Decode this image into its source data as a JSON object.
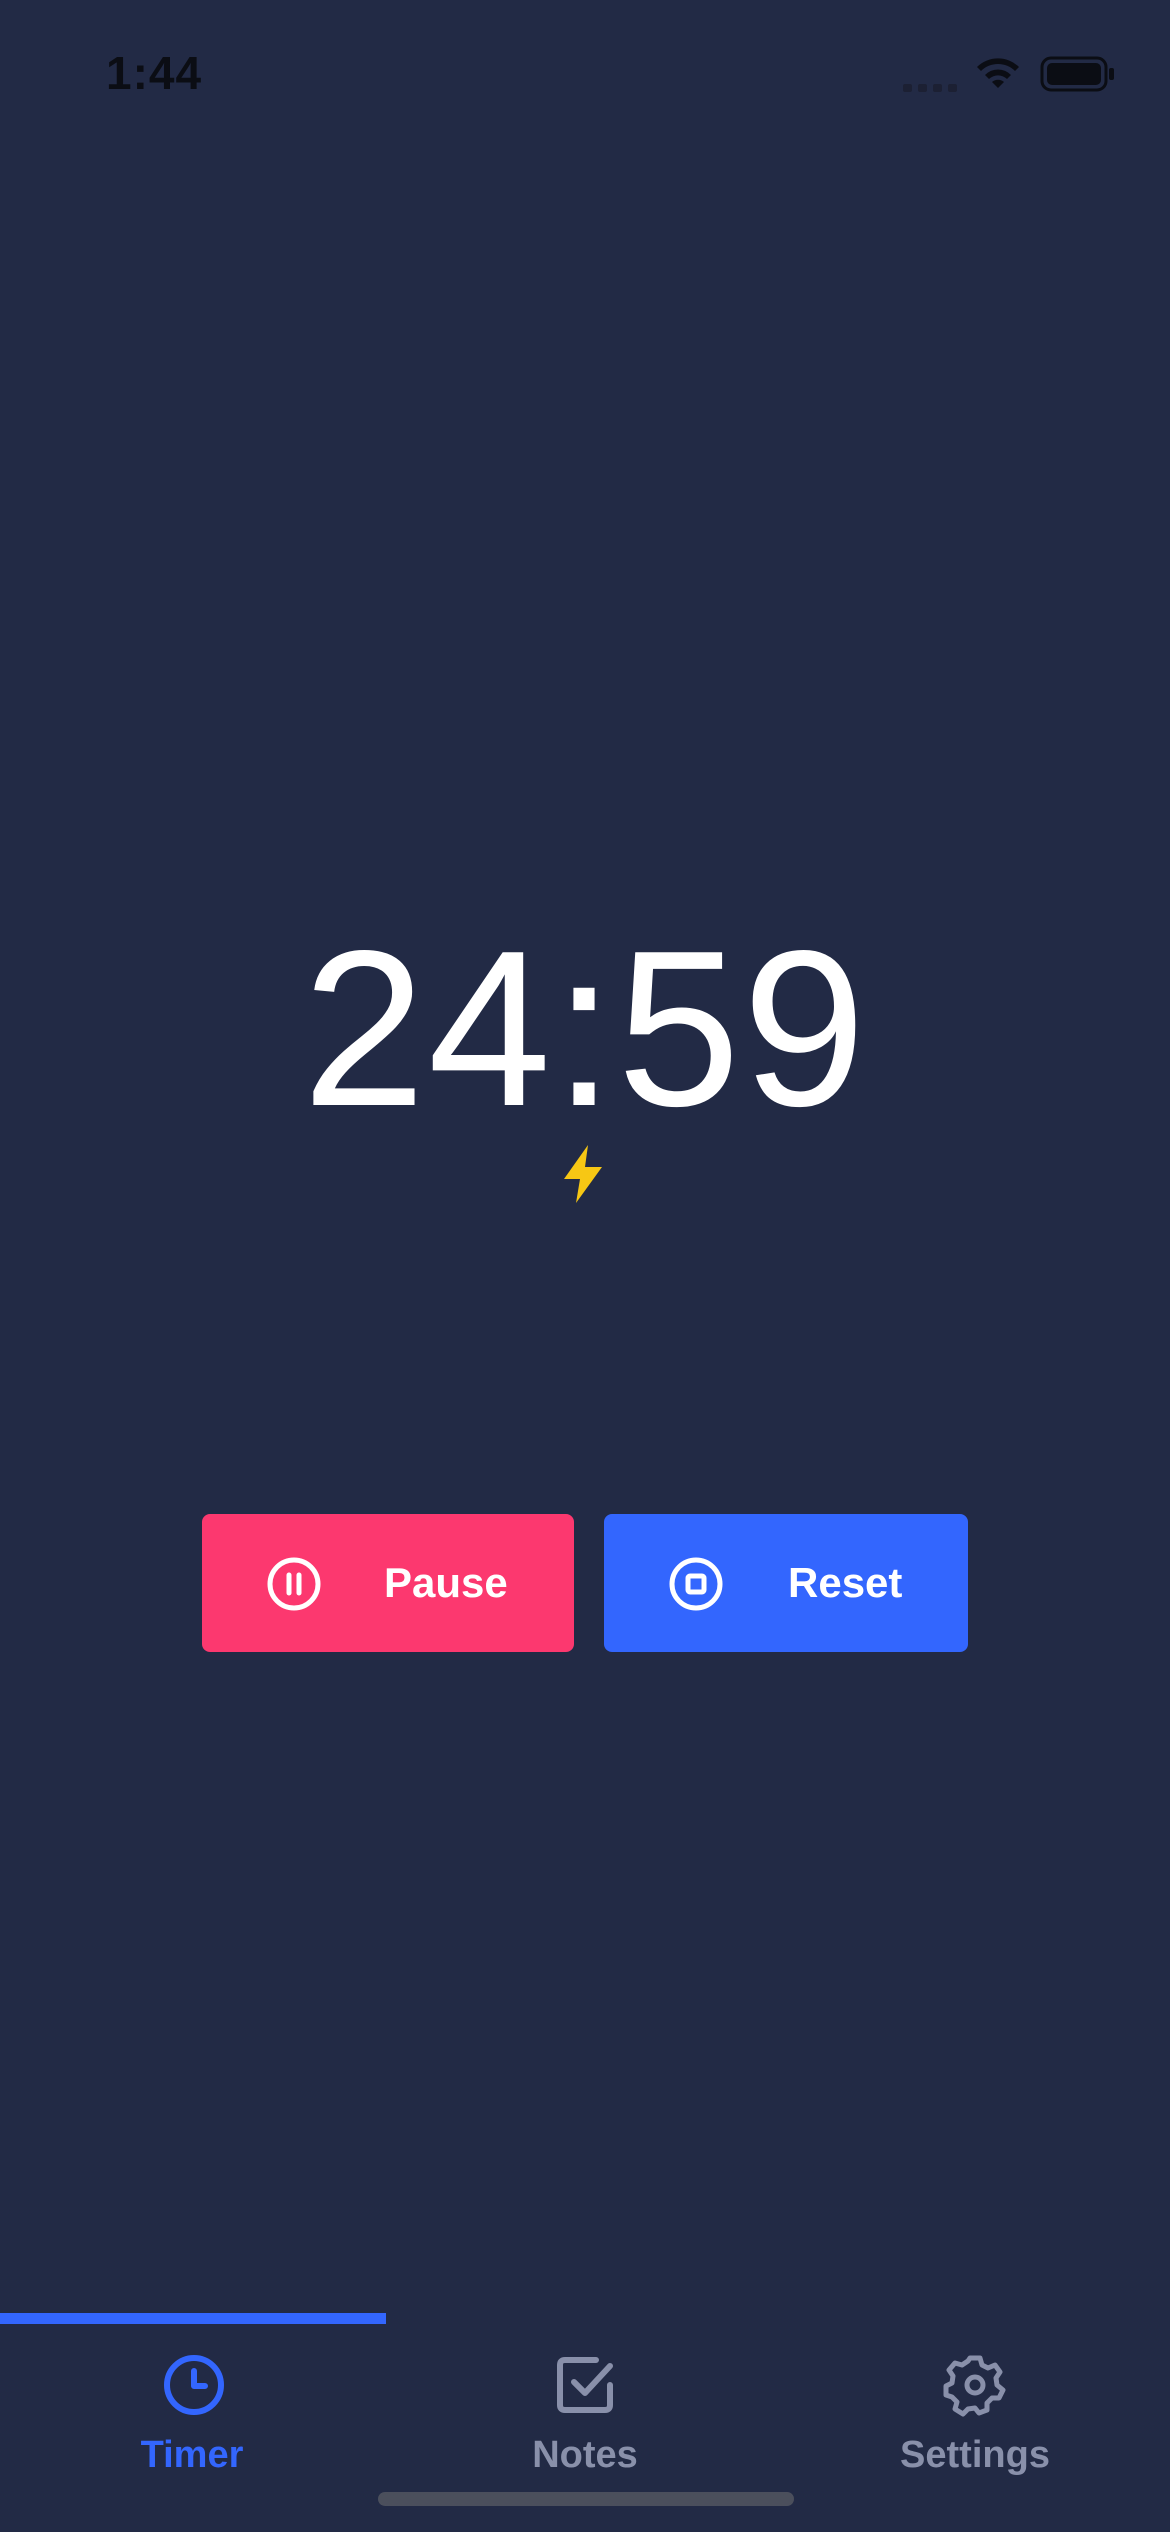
{
  "status_bar": {
    "time": "1:44"
  },
  "timer": {
    "display": "24:59"
  },
  "icons": {
    "bolt": "lightning-bolt-icon",
    "pause": "pause-circle-icon",
    "reset": "stop-circle-icon",
    "tab_timer": "clock-icon",
    "tab_notes": "checkbox-icon",
    "tab_settings": "gear-icon"
  },
  "controls": {
    "pause_label": "Pause",
    "reset_label": "Reset"
  },
  "tabs": [
    {
      "label": "Timer",
      "active": true
    },
    {
      "label": "Notes",
      "active": false
    },
    {
      "label": "Settings",
      "active": false
    }
  ],
  "tab_progress": {
    "fraction": 0.33
  },
  "colors": {
    "background": "#222a45",
    "pause": "#fc386f",
    "reset": "#3366fe",
    "accent": "#3366fe",
    "bolt": "#f7c714",
    "inactive": "#8990aa"
  }
}
